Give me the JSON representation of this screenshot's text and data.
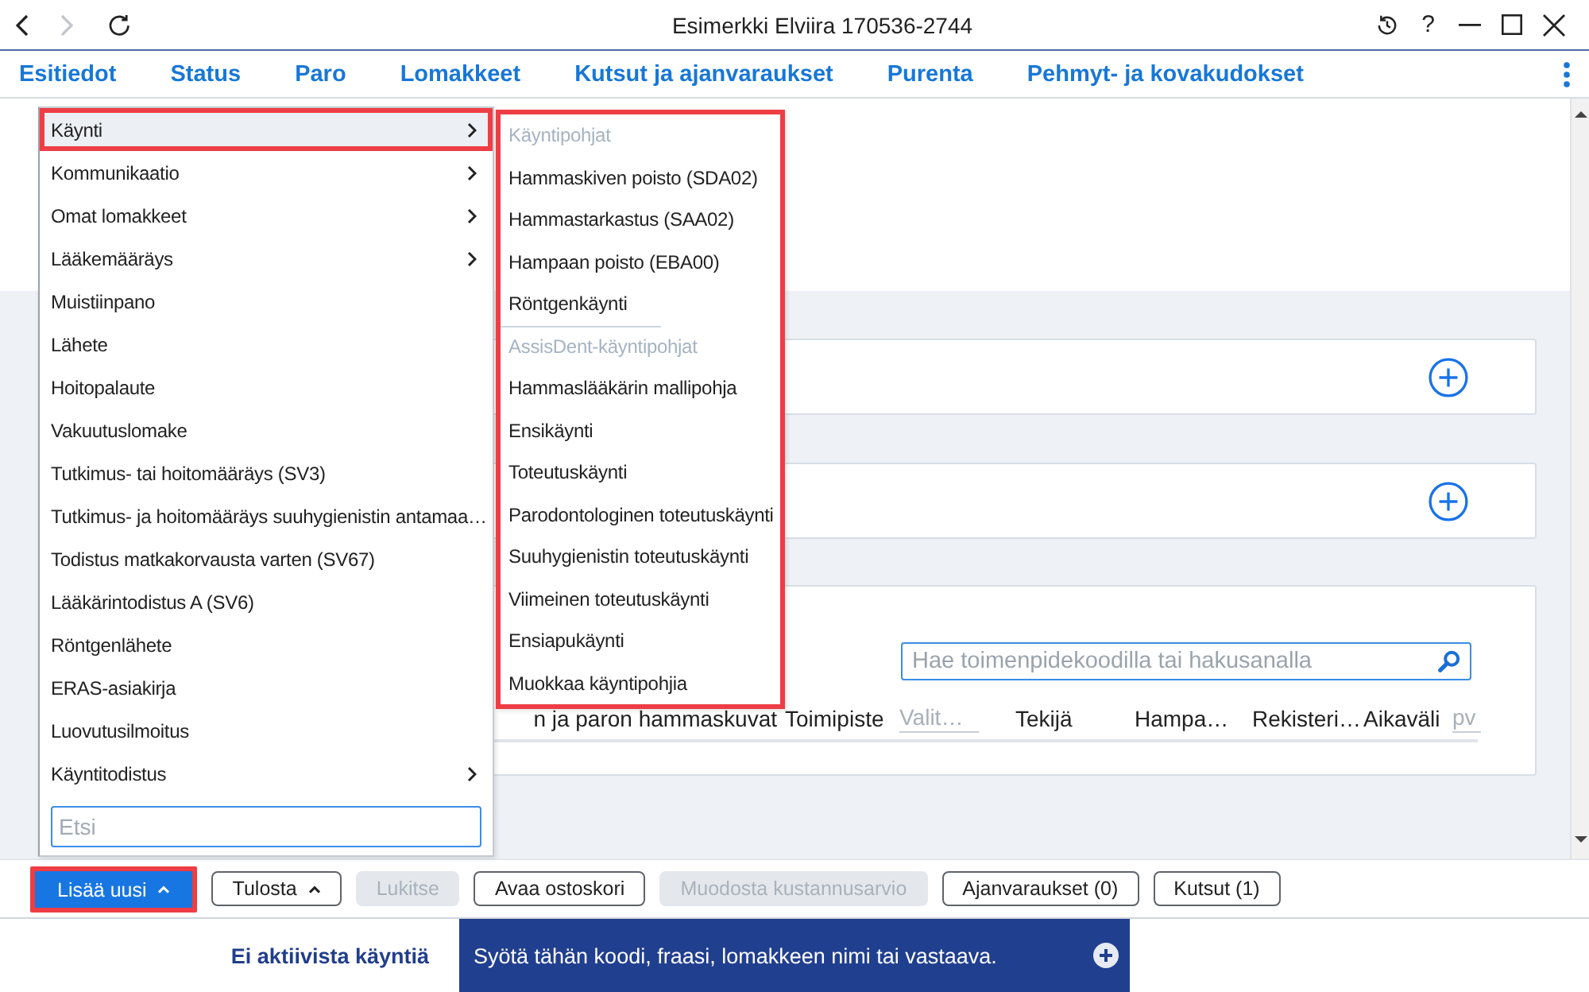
{
  "window": {
    "title": "Esimerkki Elviira 170536-2744",
    "help": "?"
  },
  "nav_buttons": [
    {
      "kind": "back",
      "disabled": false
    },
    {
      "kind": "forward",
      "disabled": true
    },
    {
      "kind": "refresh",
      "disabled": false
    }
  ],
  "tabs": [
    {
      "label": "Esitiedot"
    },
    {
      "label": "Status"
    },
    {
      "label": "Paro"
    },
    {
      "label": "Lomakkeet"
    },
    {
      "label": "Kutsut ja ajanvaraukset"
    },
    {
      "label": "Purenta"
    },
    {
      "label": "Pehmyt- ja kovakudokset"
    }
  ],
  "panel": {
    "search_placeholder": "Hae toimenpidekoodilla tai hakusanalla",
    "filters": [
      {
        "label": "n ja paron hammaskuvat"
      },
      {
        "label": "Toimipiste",
        "placeholder": "Valit…"
      },
      {
        "label": "Tekijä"
      },
      {
        "label": "Hampa…"
      },
      {
        "label": "Rekisteri…"
      },
      {
        "label": "Aikaväli",
        "placeholder": "pv"
      }
    ]
  },
  "add_menu": {
    "items": [
      {
        "label": "Käynti",
        "has_submenu": true,
        "selected": true,
        "highlighted": true
      },
      {
        "label": "Kommunikaatio",
        "has_submenu": true,
        "selected": false,
        "highlighted": false
      },
      {
        "label": "Omat lomakkeet",
        "has_submenu": true,
        "selected": false,
        "highlighted": false
      },
      {
        "label": "Lääkemääräys",
        "has_submenu": true,
        "selected": false,
        "highlighted": false
      },
      {
        "label": "Muistiinpano",
        "has_submenu": false,
        "selected": false,
        "highlighted": false
      },
      {
        "label": "Lähete",
        "has_submenu": false,
        "selected": false,
        "highlighted": false
      },
      {
        "label": "Hoitopalaute",
        "has_submenu": false,
        "selected": false,
        "highlighted": false
      },
      {
        "label": "Vakuutuslomake",
        "has_submenu": false,
        "selected": false,
        "highlighted": false
      },
      {
        "label": "Tutkimus- tai hoitomääräys (SV3)",
        "has_submenu": false,
        "selected": false,
        "highlighted": false
      },
      {
        "label": "Tutkimus- ja hoitomääräys suuhygienistin antamaa…",
        "has_submenu": false,
        "selected": false,
        "highlighted": false
      },
      {
        "label": "Todistus matkakorvausta varten (SV67)",
        "has_submenu": false,
        "selected": false,
        "highlighted": false
      },
      {
        "label": "Lääkärintodistus A (SV6)",
        "has_submenu": false,
        "selected": false,
        "highlighted": false
      },
      {
        "label": "Röntgenlähete",
        "has_submenu": false,
        "selected": false,
        "highlighted": false
      },
      {
        "label": "ERAS-asiakirja",
        "has_submenu": false,
        "selected": false,
        "highlighted": false
      },
      {
        "label": "Luovutusilmoitus",
        "has_submenu": false,
        "selected": false,
        "highlighted": false
      },
      {
        "label": "Käyntitodistus",
        "has_submenu": true,
        "selected": false,
        "highlighted": false
      }
    ],
    "search_placeholder": "Etsi"
  },
  "submenu": {
    "highlighted": true,
    "groups": [
      {
        "header": "Käyntipohjat",
        "items": [
          "Hammaskiven poisto (SDA02)",
          "Hammastarkastus (SAA02)",
          "Hampaan poisto (EBA00)",
          "Röntgenkäynti"
        ]
      },
      {
        "header": "AssisDent-käyntipohjat",
        "items": [
          "Hammaslääkärin mallipohja",
          "Ensikäynti",
          "Toteutuskäynti",
          "Parodontologinen toteutuskäynti",
          "Suuhygienistin toteutuskäynti",
          "Viimeinen toteutuskäynti",
          "Ensiapukäynti",
          "Muokkaa käyntipohjia"
        ]
      }
    ]
  },
  "toolbar": [
    {
      "label": "Lisää uusi",
      "kind": "primary",
      "caret": true,
      "disabled": false,
      "highlighted": true
    },
    {
      "label": "Tulosta",
      "kind": "default",
      "caret": true,
      "disabled": false,
      "highlighted": false
    },
    {
      "label": "Lukitse",
      "kind": "default",
      "caret": false,
      "disabled": true,
      "highlighted": false
    },
    {
      "label": "Avaa ostoskori",
      "kind": "default",
      "caret": false,
      "disabled": false,
      "highlighted": false
    },
    {
      "label": "Muodosta kustannusarvio",
      "kind": "default",
      "caret": false,
      "disabled": true,
      "highlighted": false
    },
    {
      "label": "Ajanvaraukset (0)",
      "kind": "default",
      "caret": false,
      "disabled": false,
      "highlighted": false
    },
    {
      "label": "Kutsut (1)",
      "kind": "default",
      "caret": false,
      "disabled": false,
      "highlighted": false
    }
  ],
  "footer": {
    "status": "Ei aktiivista käyntiä",
    "command_placeholder": "Syötä tähän koodi, fraasi, lomakkeen nimi tai vastaava."
  }
}
